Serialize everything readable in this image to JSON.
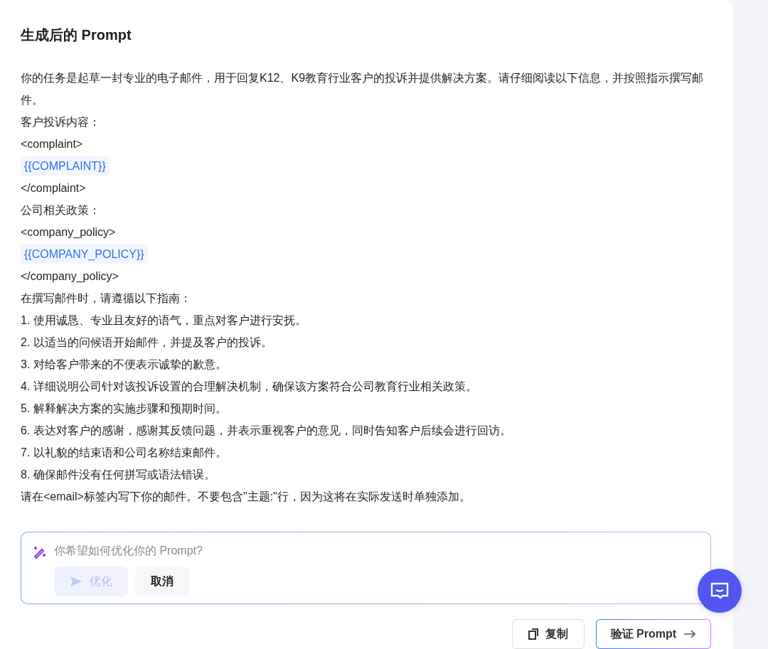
{
  "title": "生成后的 Prompt",
  "lines": [
    {
      "kind": "text",
      "text": "你的任务是起草一封专业的电子邮件，用于回复K12、K9教育行业客户的投诉并提供解决方案。请仔细阅读以下信息，并按照指示撰写邮件。"
    },
    {
      "kind": "text",
      "text": "客户投诉内容："
    },
    {
      "kind": "text",
      "text": "<complaint>"
    },
    {
      "kind": "variable",
      "text": "{{COMPLAINT}}"
    },
    {
      "kind": "text",
      "text": "</complaint>"
    },
    {
      "kind": "text",
      "text": "公司相关政策："
    },
    {
      "kind": "text",
      "text": "<company_policy>"
    },
    {
      "kind": "variable",
      "text": "{{COMPANY_POLICY}}"
    },
    {
      "kind": "text",
      "text": "</company_policy>"
    },
    {
      "kind": "text",
      "text": "在撰写邮件时，请遵循以下指南："
    },
    {
      "kind": "text",
      "text": "1. 使用诚恳、专业且友好的语气，重点对客户进行安抚。"
    },
    {
      "kind": "text",
      "text": "2. 以适当的问候语开始邮件，并提及客户的投诉。"
    },
    {
      "kind": "text",
      "text": "3. 对给客户带来的不便表示诚挚的歉意。"
    },
    {
      "kind": "text",
      "text": "4. 详细说明公司针对该投诉设置的合理解决机制，确保该方案符合公司教育行业相关政策。"
    },
    {
      "kind": "text",
      "text": "5. 解释解决方案的实施步骤和预期时间。"
    },
    {
      "kind": "text",
      "text": "6. 表达对客户的感谢，感谢其反馈问题，并表示重视客户的意见，同时告知客户后续会进行回访。"
    },
    {
      "kind": "text",
      "text": "7. 以礼貌的结束语和公司名称结束邮件。"
    },
    {
      "kind": "text",
      "text": "8. 确保邮件没有任何拼写或语法错误。"
    },
    {
      "kind": "text",
      "text": "请在<email>标签内写下你的邮件。不要包含\"主题:\"行，因为这将在实际发送时单独添加。"
    }
  ],
  "optimize": {
    "placeholder": "你希望如何优化你的 Prompt?",
    "buttons": [
      {
        "label": "优化",
        "disabled": true
      },
      {
        "label": "取消",
        "disabled": false
      }
    ]
  },
  "actions": [
    {
      "kind": "copy",
      "label": "复制"
    },
    {
      "kind": "verify",
      "label": "验证 Prompt"
    }
  ]
}
